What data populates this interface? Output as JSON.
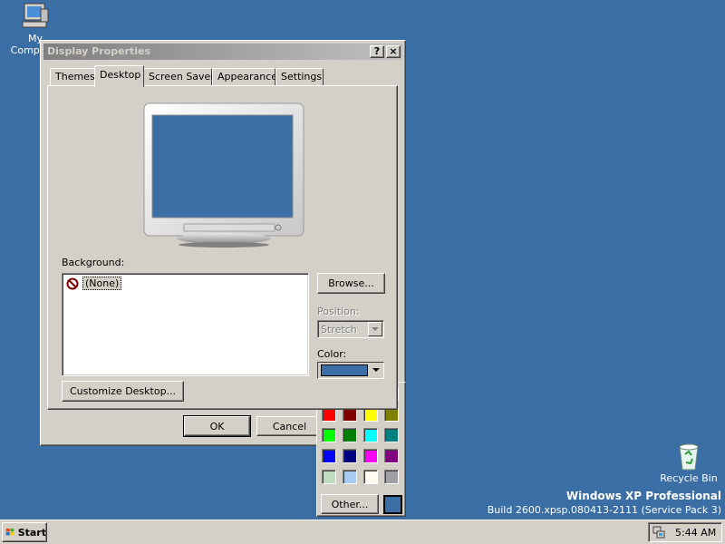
{
  "desktop": {
    "my_computer_label": "My Computer",
    "recycle_bin_label": "Recycle Bin",
    "watermark_line1": "Windows XP Professional",
    "watermark_line2": "Build 2600.xpsp.080413-2111 (Service Pack 3)"
  },
  "window": {
    "title": "Display Properties",
    "help_glyph": "?",
    "close_glyph": "×",
    "tabs": [
      {
        "label": "Themes"
      },
      {
        "label": "Desktop"
      },
      {
        "label": "Screen Saver"
      },
      {
        "label": "Appearance"
      },
      {
        "label": "Settings"
      }
    ],
    "active_tab": "Desktop",
    "background_label": "Background:",
    "background_items": [
      {
        "label": "(None)",
        "selected": true
      }
    ],
    "browse_label": "Browse...",
    "position_label": "Position:",
    "position_value": "Stretch",
    "color_label": "Color:",
    "selected_color": "#3a6ea5",
    "customize_label": "Customize Desktop...",
    "ok_label": "OK",
    "cancel_label": "Cancel"
  },
  "color_picker": {
    "swatches": [
      "#ffffff",
      "#000000",
      "#c0c0c0",
      "#808080",
      "#ff0000",
      "#800000",
      "#ffff00",
      "#808000",
      "#00ff00",
      "#008000",
      "#00ffff",
      "#008080",
      "#0000ff",
      "#000080",
      "#ff00ff",
      "#800080",
      "#c0dcc0",
      "#a6caf0",
      "#fffbf0",
      "#a0a0a4"
    ],
    "other_label": "Other...",
    "current_color": "#3a6ea5"
  },
  "taskbar": {
    "start_label": "Start",
    "clock": "5:44 AM"
  }
}
